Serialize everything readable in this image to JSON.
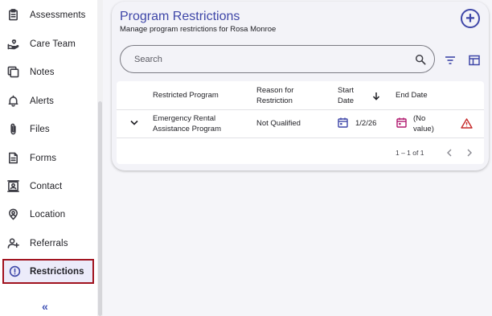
{
  "sidebar": {
    "items": [
      {
        "label": "Assessments",
        "icon": "clipboard-icon",
        "active": false
      },
      {
        "label": "Care Team",
        "icon": "hand-heart-icon",
        "active": false
      },
      {
        "label": "Notes",
        "icon": "notes-icon",
        "active": false
      },
      {
        "label": "Alerts",
        "icon": "bell-icon",
        "active": false
      },
      {
        "label": "Files",
        "icon": "paperclip-icon",
        "active": false
      },
      {
        "label": "Forms",
        "icon": "document-icon",
        "active": false
      },
      {
        "label": "Contact",
        "icon": "contact-card-icon",
        "active": false
      },
      {
        "label": "Location",
        "icon": "location-pin-icon",
        "active": false
      },
      {
        "label": "Referrals",
        "icon": "person-add-icon",
        "active": false
      },
      {
        "label": "Restrictions",
        "icon": "exclamation-circle-icon",
        "active": true
      }
    ],
    "collapse_label": "«"
  },
  "main": {
    "title": "Program Restrictions",
    "subtitle": "Manage program restrictions for Rosa Monroe",
    "add_button": "+",
    "search": {
      "placeholder": "Search",
      "value": ""
    },
    "table": {
      "columns": [
        "Restricted Program",
        "Reason for Restriction",
        "Start Date",
        "End Date"
      ],
      "sort": {
        "column": "Start Date",
        "direction": "descending"
      },
      "rows": [
        {
          "program": "Emergency Rental Assistance Program",
          "reason": "Not Qualified",
          "start_date": "1/2/26",
          "end_date": "(No value)",
          "warning": true
        }
      ],
      "pagination": {
        "range": "1 – 1 of 1"
      }
    }
  },
  "colors": {
    "accent": "#3f47a8",
    "active_outline": "#a1121e",
    "start_calendar": "#3f47a8",
    "end_calendar": "#b0186e",
    "warning": "#c62828"
  }
}
